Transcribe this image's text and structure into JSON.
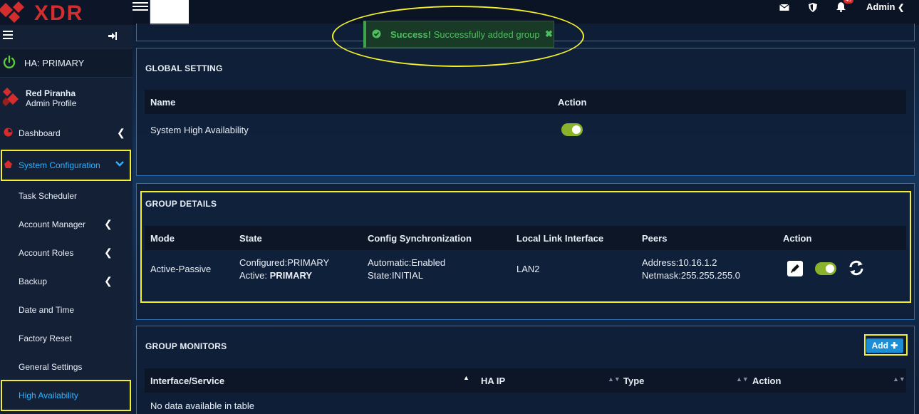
{
  "app": {
    "brand": "XDR"
  },
  "topbar": {
    "user": "Admin",
    "bell_badge": "43"
  },
  "toast": {
    "strong": "Success!",
    "message": "Successfully added group"
  },
  "sidebar": {
    "ha_label": "HA:  PRIMARY",
    "profile_name": "Red Piranha",
    "profile_role": "Admin Profile",
    "items": [
      {
        "label": "Dashboard"
      },
      {
        "label": "System Configuration"
      },
      {
        "label": "Task Scheduler"
      },
      {
        "label": "Account Manager"
      },
      {
        "label": "Account Roles"
      },
      {
        "label": "Backup"
      },
      {
        "label": "Date and Time"
      },
      {
        "label": "Factory Reset"
      },
      {
        "label": "General Settings"
      },
      {
        "label": "High Availability"
      }
    ]
  },
  "global_setting": {
    "title": "GLOBAL SETTING",
    "headers": [
      "Name",
      "Action"
    ],
    "row": {
      "name": "System High Availability",
      "enabled": true
    }
  },
  "group_details": {
    "title": "GROUP DETAILS",
    "headers": [
      "Mode",
      "State",
      "Config Synchronization",
      "Local Link Interface",
      "Peers",
      "Action"
    ],
    "row": {
      "mode": "Active-Passive",
      "state_configured": "Configured:PRIMARY",
      "state_active_label": "Active:",
      "state_active_value": "PRIMARY",
      "sync_line1": "Automatic:Enabled",
      "sync_line2": "State:INITIAL",
      "interface": "LAN2",
      "peer_address": "Address:10.16.1.2",
      "peer_netmask": "Netmask:255.255.255.0",
      "enabled": true
    }
  },
  "group_monitors": {
    "title": "GROUP MONITORS",
    "add_label": "Add",
    "headers": [
      "Interface/Service",
      "HA IP",
      "Type",
      "Action"
    ],
    "empty": "No data available in table"
  },
  "colors": {
    "accent": "#2fb3ff",
    "highlight": "#f4ef2c",
    "success": "#4dbf5e",
    "toggle_on": "#8ab22a",
    "brand_red": "#d42d2d"
  }
}
